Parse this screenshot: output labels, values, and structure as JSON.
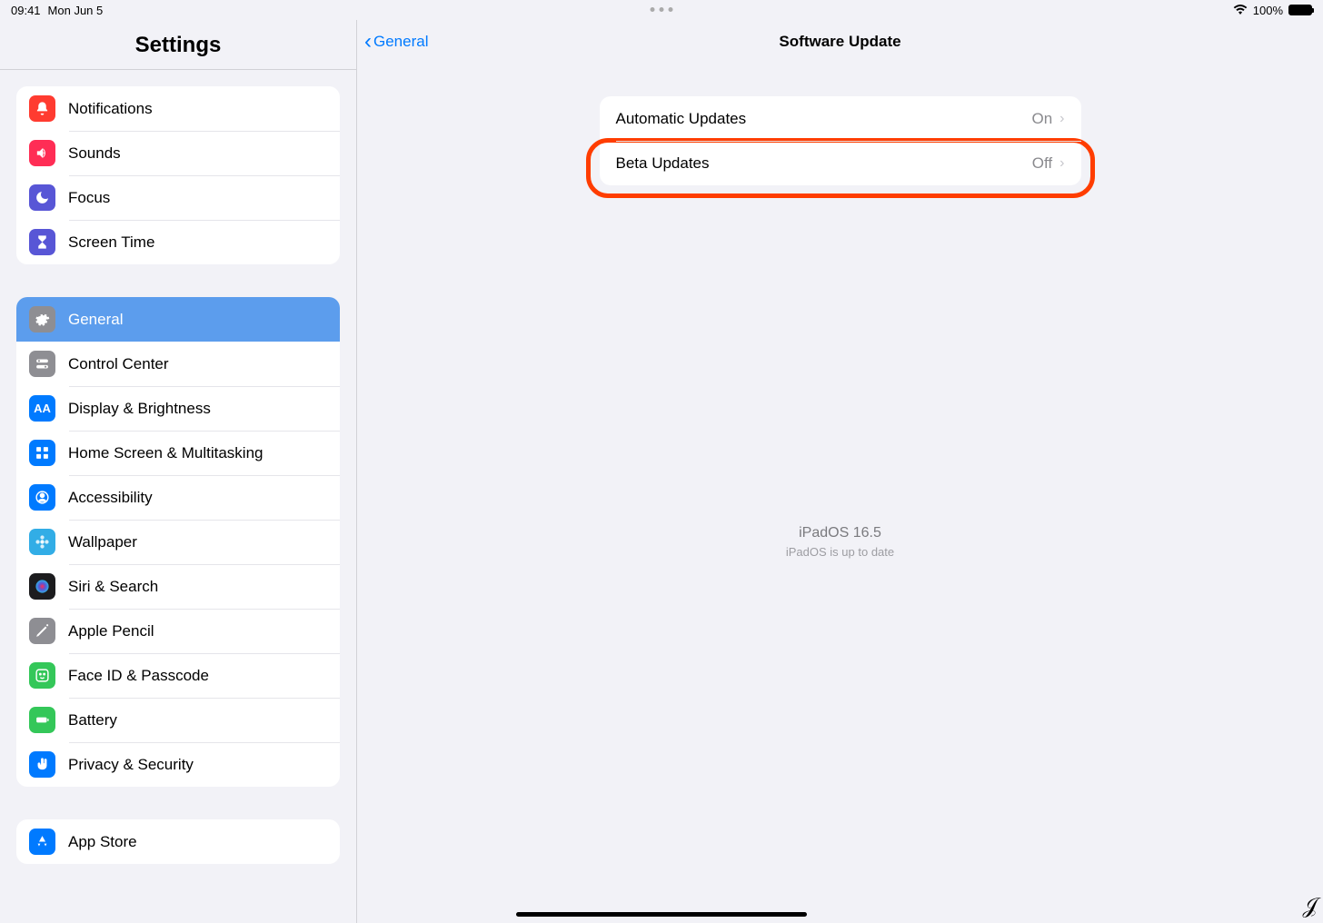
{
  "status": {
    "time": "09:41",
    "date": "Mon Jun 5",
    "battery": "100%"
  },
  "sidebar": {
    "title": "Settings",
    "group1": [
      {
        "label": "Notifications",
        "icon": "bell",
        "bg": "bg-red"
      },
      {
        "label": "Sounds",
        "icon": "speaker",
        "bg": "bg-pink"
      },
      {
        "label": "Focus",
        "icon": "moon",
        "bg": "bg-purple"
      },
      {
        "label": "Screen Time",
        "icon": "hourglass",
        "bg": "bg-purple"
      }
    ],
    "group2": [
      {
        "label": "General",
        "icon": "gear",
        "bg": "bg-grey",
        "selected": true
      },
      {
        "label": "Control Center",
        "icon": "toggles",
        "bg": "bg-grey"
      },
      {
        "label": "Display & Brightness",
        "icon": "aa",
        "bg": "bg-blue"
      },
      {
        "label": "Home Screen & Multitasking",
        "icon": "grid",
        "bg": "bg-blue"
      },
      {
        "label": "Accessibility",
        "icon": "person",
        "bg": "bg-blue"
      },
      {
        "label": "Wallpaper",
        "icon": "flower",
        "bg": "bg-cyan"
      },
      {
        "label": "Siri & Search",
        "icon": "siri",
        "bg": "bg-black"
      },
      {
        "label": "Apple Pencil",
        "icon": "pencil",
        "bg": "bg-grey"
      },
      {
        "label": "Face ID & Passcode",
        "icon": "face",
        "bg": "bg-green"
      },
      {
        "label": "Battery",
        "icon": "battery",
        "bg": "bg-green"
      },
      {
        "label": "Privacy & Security",
        "icon": "hand",
        "bg": "bg-blue"
      }
    ],
    "group3": [
      {
        "label": "App Store",
        "icon": "appstore",
        "bg": "bg-blue"
      }
    ]
  },
  "main": {
    "back": "General",
    "title": "Software Update",
    "rows": [
      {
        "label": "Automatic Updates",
        "value": "On"
      },
      {
        "label": "Beta Updates",
        "value": "Off",
        "highlighted": true
      }
    ],
    "status_version": "iPadOS 16.5",
    "status_msg": "iPadOS is up to date"
  }
}
